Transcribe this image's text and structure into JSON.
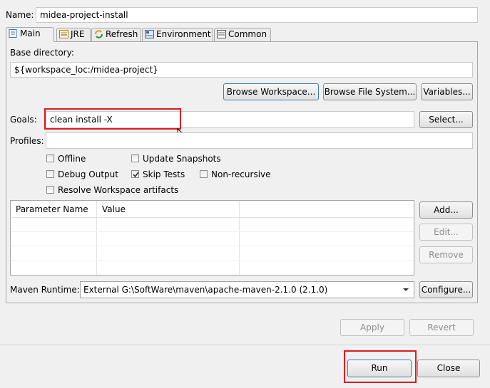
{
  "name": {
    "label": "Name:",
    "value": "midea-project-install"
  },
  "tabs": [
    {
      "label": "Main",
      "icon": "main-tab-icon"
    },
    {
      "label": "JRE",
      "icon": "jre-icon"
    },
    {
      "label": "Refresh",
      "icon": "refresh-icon"
    },
    {
      "label": "Environment",
      "icon": "environment-icon"
    },
    {
      "label": "Common",
      "icon": "common-icon"
    }
  ],
  "base_directory": {
    "label": "Base directory:",
    "value": "${workspace_loc:/midea-project}",
    "browse_workspace": "Browse Workspace...",
    "browse_file_system": "Browse File System...",
    "variables": "Variables..."
  },
  "goals": {
    "label": "Goals:",
    "value": "clean install -X",
    "select": "Select..."
  },
  "profiles": {
    "label": "Profiles:",
    "value": ""
  },
  "options": {
    "offline": {
      "label": "Offline",
      "checked": false
    },
    "update_snapshots": {
      "label": "Update Snapshots",
      "checked": false
    },
    "debug_output": {
      "label": "Debug Output",
      "checked": false
    },
    "skip_tests": {
      "label": "Skip Tests",
      "checked": true
    },
    "non_recursive": {
      "label": "Non-recursive",
      "checked": false
    },
    "resolve_workspace": {
      "label": "Resolve Workspace artifacts",
      "checked": false
    }
  },
  "parameters": {
    "columns": [
      "Parameter Name",
      "Value"
    ],
    "rows": [],
    "add": "Add...",
    "edit": "Edit...",
    "remove": "Remove"
  },
  "runtime": {
    "label": "Maven Runtime:",
    "value": "External G:\\SoftWare\\maven\\apache-maven-2.1.0 (2.1.0)",
    "configure": "Configure..."
  },
  "footer": {
    "apply": "Apply",
    "revert": "Revert",
    "run": "Run",
    "close": "Close"
  },
  "colors": {
    "highlight": "#e0181f",
    "window_bg": "#f0f0f0"
  }
}
